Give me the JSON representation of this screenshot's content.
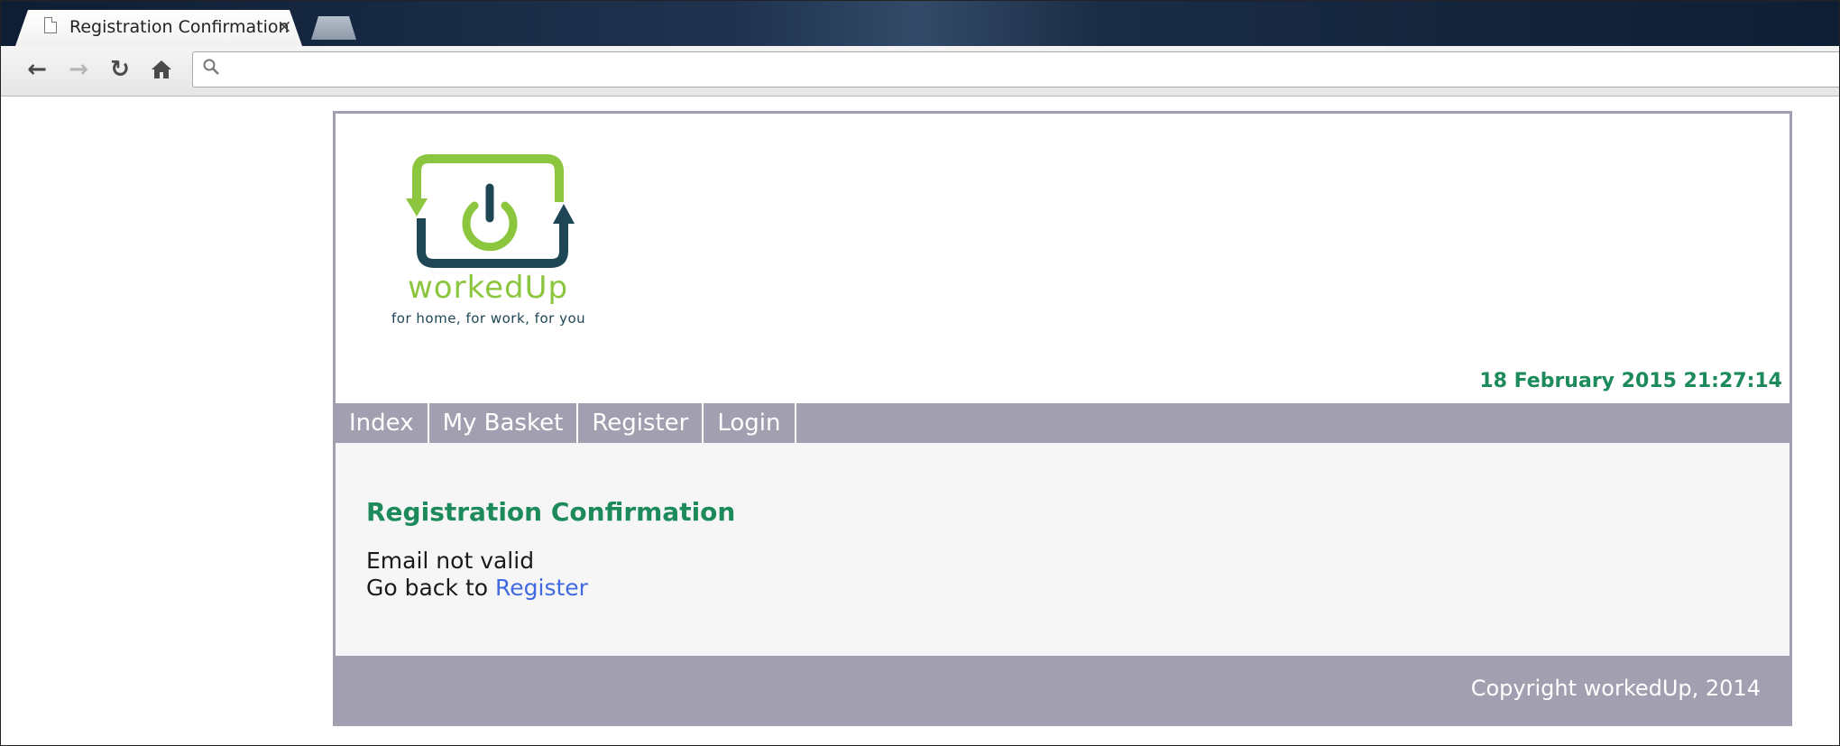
{
  "browser": {
    "tab_title": "Registration Confirmation",
    "tab_close": "×",
    "address": ""
  },
  "header": {
    "logo_text": "workedUp",
    "tagline": "for home, for work, for you",
    "datetime": "18 February 2015 21:27:14"
  },
  "nav": {
    "items": [
      {
        "label": "Index"
      },
      {
        "label": "My Basket"
      },
      {
        "label": "Register"
      },
      {
        "label": "Login"
      }
    ]
  },
  "content": {
    "title": "Registration Confirmation",
    "message": "Email not valid",
    "go_back_text": "Go back to",
    "go_back_link": "Register"
  },
  "footer": {
    "copyright": "Copyright workedUp, 2014"
  },
  "colors": {
    "accent_green": "#1c8a5a",
    "logo_green": "#8cc63e",
    "logo_dark": "#1e4655",
    "nav_bg": "#a19fb0",
    "link": "#4169e1"
  }
}
